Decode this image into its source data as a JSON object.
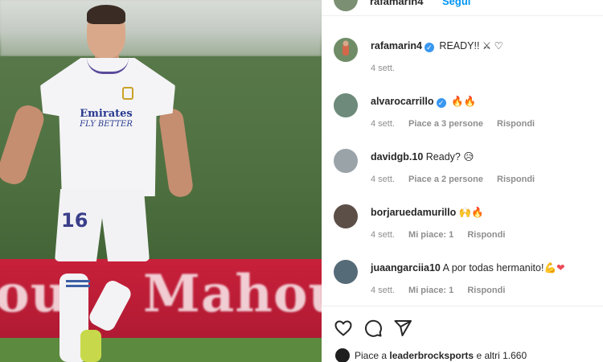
{
  "post": {
    "author": "rafamarin4",
    "follow_label": "Segui",
    "caption_text": "READY!!",
    "caption_emoji": "⚔ ♡",
    "caption_time": "4 sett."
  },
  "billboard": {
    "left_text": "ou",
    "right_text": "Mahou"
  },
  "player": {
    "sponsor_line1": "Emirates",
    "sponsor_line2": "FLY BETTER",
    "number": "16"
  },
  "comments": [
    {
      "user": "alvarocarrillo",
      "verified": true,
      "text": "",
      "emoji": "🔥🔥",
      "time": "4 sett.",
      "likes": "Piace a 3 persone",
      "reply": "Rispondi",
      "avatar_color": "#6d8a7a"
    },
    {
      "user": "davidgb.10",
      "verified": false,
      "text": "Ready?",
      "emoji": "😥",
      "time": "4 sett.",
      "likes": "Piace a 2 persone",
      "reply": "Rispondi",
      "avatar_color": "#9aa3a8"
    },
    {
      "user": "borjaruedamurillo",
      "verified": false,
      "text": "",
      "emoji": "🙌🔥",
      "time": "4 sett.",
      "likes": "Mi piace: 1",
      "reply": "Rispondi",
      "avatar_color": "#5c4f48"
    },
    {
      "user": "juaangarciia10",
      "verified": false,
      "text": "A por todas hermanito!",
      "emoji": "💪❤",
      "time": "4 sett.",
      "likes": "Mi piace: 1",
      "reply": "Rispondi",
      "avatar_color": "#566b78"
    }
  ],
  "actions": {
    "like_icon": "heart-icon",
    "comment_icon": "comment-icon",
    "share_icon": "share-icon",
    "liked_by_prefix": "Piace a",
    "liked_by_user": "leaderbrocksports",
    "liked_by_suffix": "e altri 1.660"
  },
  "colors": {
    "link": "#0095f6",
    "verified": "#3897f0",
    "muted": "#8e8e8e",
    "billboard": "#c8203a"
  }
}
